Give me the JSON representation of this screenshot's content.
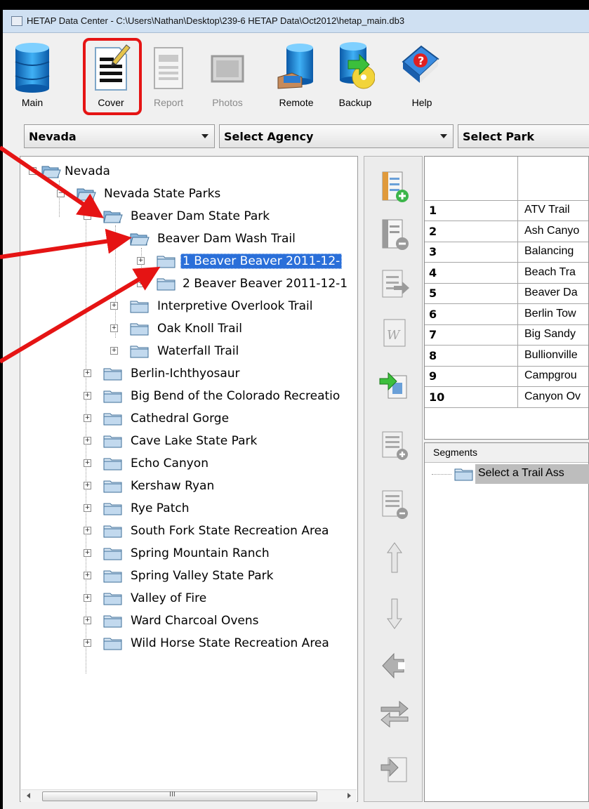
{
  "window": {
    "title": "HETAP Data Center - C:\\Users\\Nathan\\Desktop\\239-6 HETAP Data\\Oct2012\\hetap_main.db3"
  },
  "toolbar": {
    "main_label": "Main",
    "cover_label": "Cover",
    "report_label": "Report",
    "photos_label": "Photos",
    "remote_label": "Remote",
    "backup_label": "Backup",
    "help_label": "Help",
    "highlighted": "Cover"
  },
  "selectors": {
    "state": "Nevada",
    "agency": "Select Agency",
    "park": "Select Park"
  },
  "tree": {
    "root": "Nevada",
    "agency": "Nevada State Parks",
    "park": "Beaver Dam State Park",
    "trail": "Beaver Dam Wash Trail",
    "assessments": [
      "1  Beaver Beaver 2011-12-",
      "2 Beaver Beaver 2011-12-1"
    ],
    "selected_assessment_index": 0,
    "other_trails": [
      "Interpretive Overlook Trail",
      "Oak Knoll Trail",
      "Waterfall Trail"
    ],
    "other_parks": [
      "Berlin-Ichthyosaur",
      "Big Bend of the Colorado Recreatio",
      "Cathedral Gorge",
      "Cave Lake State Park",
      "Echo Canyon",
      "Kershaw Ryan",
      "Rye Patch",
      "South Fork State Recreation Area",
      "Spring Mountain Ranch",
      "Spring Valley State Park",
      "Valley of Fire",
      "Ward Charcoal Ovens",
      "Wild Horse State Recreation Area"
    ],
    "scroll_grip": "III"
  },
  "trail_table": {
    "rows": [
      {
        "num": "1",
        "name": "ATV Trail"
      },
      {
        "num": "2",
        "name": "Ash Canyo"
      },
      {
        "num": "3",
        "name": "Balancing"
      },
      {
        "num": "4",
        "name": "Beach Tra"
      },
      {
        "num": "5",
        "name": "Beaver Da"
      },
      {
        "num": "6",
        "name": "Berlin Tow"
      },
      {
        "num": "7",
        "name": "Big Sandy"
      },
      {
        "num": "8",
        "name": "Bullionville"
      },
      {
        "num": "9",
        "name": "Campgrou"
      },
      {
        "num": "10",
        "name": "Canyon Ov"
      }
    ]
  },
  "segments": {
    "header": "Segments",
    "placeholder": "Select a Trail Ass"
  },
  "colors": {
    "highlight_red": "#e51414",
    "selection_blue": "#2a6fd9"
  }
}
